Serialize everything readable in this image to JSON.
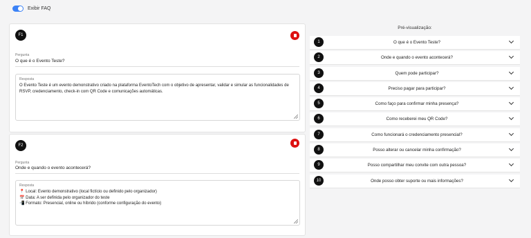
{
  "toggle": {
    "label": "Exibir FAQ",
    "on": true
  },
  "faqs": [
    {
      "badge": "F1",
      "question_label": "Pergunta",
      "question": "O que é o Evento Teste?",
      "answer_label": "Resposta",
      "answer": "O Evento Teste é um evento demonstrativo criado na plataforma EventoTech com o objetivo de apresentar, validar e simular as funcionalidades de RSVP, credenciamento, check-in com QR Code e comunicações automáticas."
    },
    {
      "badge": "F2",
      "question_label": "Pergunta",
      "question": "Onde e quando o evento acontecerá?",
      "answer_label": "Resposta",
      "answer": "📍 Local: Evento demonstrativo (local fictício ou definido pelo organizador)\n📅 Data: A ser definida pelo organizador do teste\n📲 Formato: Presencial, online ou híbrido (conforme configuração do evento)"
    }
  ],
  "preview": {
    "title": "Pré-visualização:",
    "items": [
      {
        "num": "1",
        "question": "O que é o Evento Teste?"
      },
      {
        "num": "2",
        "question": "Onde e quando o evento acontecerá?"
      },
      {
        "num": "3",
        "question": "Quem pode participar?"
      },
      {
        "num": "4",
        "question": "Preciso pagar para participar?"
      },
      {
        "num": "5",
        "question": "Como faço para confirmar minha presença?"
      },
      {
        "num": "6",
        "question": "Como receberei meu QR Code?"
      },
      {
        "num": "7",
        "question": "Como funcionará o credenciamento presencial?"
      },
      {
        "num": "8",
        "question": "Posso alterar ou cancelar minha confirmação?"
      },
      {
        "num": "9",
        "question": "Posso compartilhar meu convite com outra pessoa?"
      },
      {
        "num": "10",
        "question": "Onde posso obter suporte ou mais informações?"
      }
    ]
  },
  "colors": {
    "toggle": "#3b82f6",
    "delete": "#dd1111",
    "badge": "#111111"
  },
  "icons": {
    "delete": "trash-icon",
    "expand": "chevron-down-icon"
  }
}
